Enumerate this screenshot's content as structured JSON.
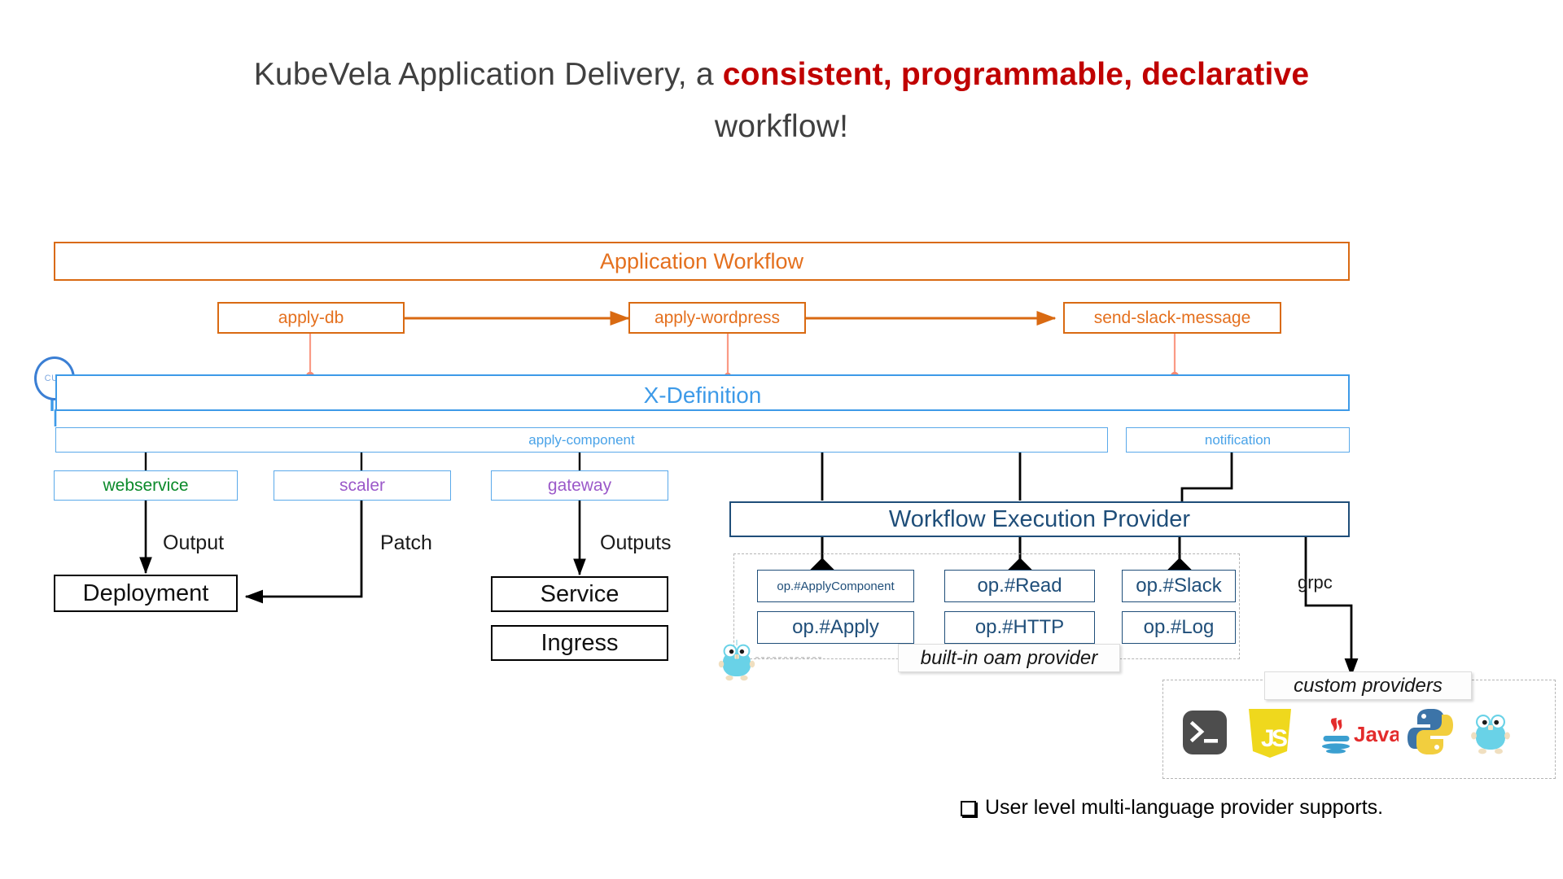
{
  "title": {
    "lead": "KubeVela Application Delivery, a ",
    "accent": "consistent, programmable, declarative",
    "tail": "workflow!"
  },
  "colors": {
    "orange": "#e4701e",
    "orange_border": "#d96a12",
    "blue": "#3d9ae8",
    "blue_light": "#5aa9ea",
    "navy": "#1f4e79",
    "green": "#0b8a2a",
    "purple": "#9b59c9",
    "accent_red": "#c00000",
    "black": "#000000",
    "salmon": "#fa8a72",
    "gopher_body": "#69d2e7",
    "dashed_gray": "#b5b5b5"
  },
  "layers": {
    "application_workflow": {
      "label": "Application Workflow",
      "steps": [
        {
          "label": "apply-db"
        },
        {
          "label": "apply-wordpress"
        },
        {
          "label": "send-slack-message"
        }
      ]
    },
    "x_definition": {
      "label": "X-Definition",
      "cue_badge": "CUE",
      "groups": [
        {
          "label": "apply-component"
        },
        {
          "label": "notification"
        }
      ]
    },
    "components": [
      {
        "label": "webservice",
        "color": "#0b8a2a"
      },
      {
        "label": "scaler",
        "color": "#9b59c9"
      },
      {
        "label": "gateway",
        "color": "#9b59c9"
      }
    ],
    "edge_labels": {
      "output": "Output",
      "patch": "Patch",
      "outputs": "Outputs",
      "grpc": "grpc"
    },
    "k8s_resources": [
      {
        "label": "Deployment"
      },
      {
        "label": "Service"
      },
      {
        "label": "Ingress"
      }
    ],
    "workflow_execution_provider": {
      "label": "Workflow Execution Provider",
      "builtin_tag": "built-in oam provider",
      "ops": [
        {
          "label": "op.#ApplyComponent",
          "small": true
        },
        {
          "label": "op.#Apply",
          "small": false
        },
        {
          "label": "op.#Read",
          "small": false
        },
        {
          "label": "op.#HTTP",
          "small": false
        },
        {
          "label": "op.#Slack",
          "small": false
        },
        {
          "label": "op.#Log",
          "small": false
        }
      ]
    },
    "custom_providers": {
      "tag": "custom providers",
      "icons": [
        {
          "name": "shell-terminal-icon",
          "label": ""
        },
        {
          "name": "javascript-icon",
          "label": "JS"
        },
        {
          "name": "java-icon",
          "label": "Java"
        },
        {
          "name": "python-icon",
          "label": ""
        },
        {
          "name": "golang-gopher-icon",
          "label": ""
        }
      ]
    }
  },
  "footer": {
    "note": "User level multi-language provider supports."
  }
}
